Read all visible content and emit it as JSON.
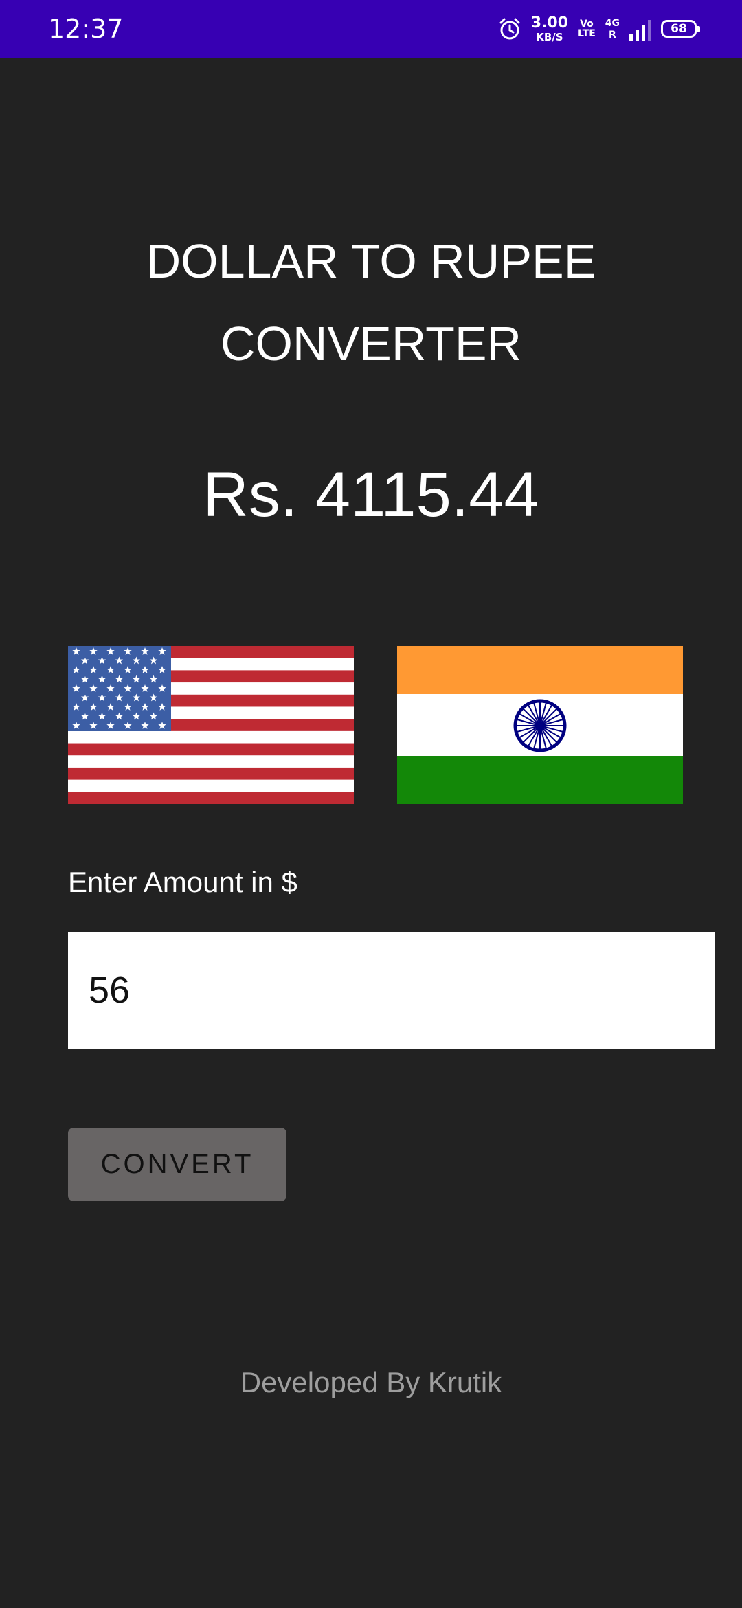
{
  "status_bar": {
    "time": "12:37",
    "net_speed_value": "3.00",
    "net_speed_unit": "KB/S",
    "volte_top": "Vo",
    "volte_bottom": "LTE",
    "network_type": "4G",
    "roaming": "R",
    "battery_level": "68",
    "icons": [
      "alarm-icon",
      "signal-icon",
      "battery-icon"
    ]
  },
  "app": {
    "title_line1": "DOLLAR TO RUPEE",
    "title_line2": "CONVERTER",
    "result": "Rs. 4115.44",
    "flags": [
      "us-flag",
      "india-flag"
    ],
    "input_label": "Enter Amount in $",
    "amount_value": "56",
    "convert_label": "CONVERT",
    "footer": "Developed By Krutik"
  },
  "colors": {
    "status_bar": "#3700b3",
    "background": "#222222",
    "button": "#686565",
    "saffron": "#ff9933",
    "india_green": "#138808",
    "chakra_blue": "#000080",
    "us_red": "#b22234",
    "us_blue": "#3c3b6e"
  }
}
